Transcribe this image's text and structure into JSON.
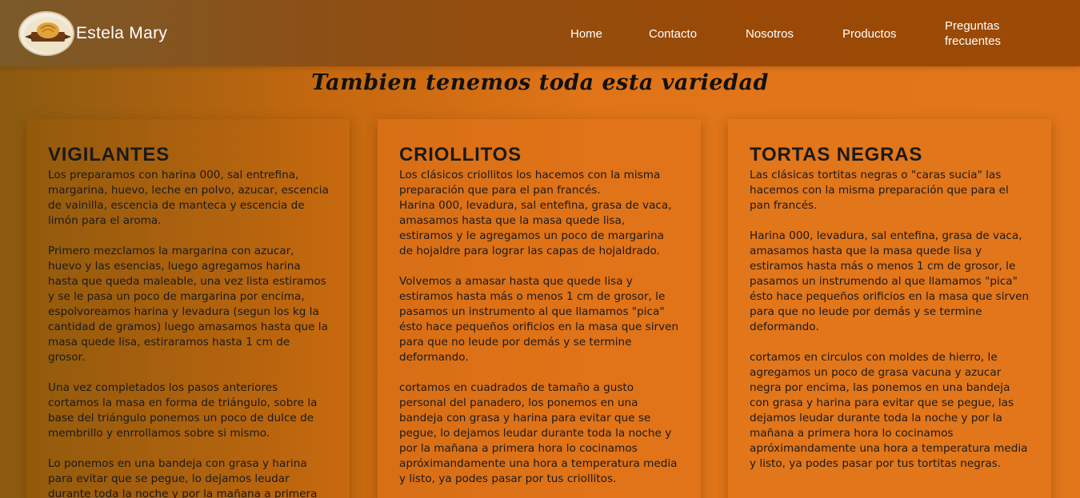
{
  "brand": {
    "name": "Estela Mary",
    "logo_icon": "bread-logo-icon"
  },
  "nav": {
    "home": "Home",
    "contacto": "Contacto",
    "nosotros": "Nosotros",
    "productos": "Productos",
    "faq": "Preguntas frecuentes"
  },
  "section": {
    "title": "Tambien tenemos toda esta variedad"
  },
  "cards": [
    {
      "title": "VIGILANTES",
      "paragraphs": [
        "Los preparamos con harina 000, sal entrefina, margarina, huevo, leche en polvo, azucar, escencia de vainilla, escencia de manteca y escencia de limón para el aroma.",
        "Primero mezclamos la margarina con azucar, huevo y las esencias, luego agregamos harina hasta que queda maleable, una vez lista estiramos y se le pasa un poco de margarina por encima, espolvoreamos harina y levadura (segun los kg la cantidad de gramos) luego amasamos hasta que la masa quede lisa, estiraramos hasta 1 cm de grosor.",
        "Una vez completados los pasos anteriores cortamos la masa en forma de triángulo, sobre la base del triángulo ponemos un poco de dulce de membrillo y enrrollamos sobre si mismo.",
        "Lo ponemos en una bandeja con grasa y harina para evitar que se pegue, lo dejamos leudar durante toda la noche y por la mañana a primera"
      ]
    },
    {
      "title": "CRIOLLITOS",
      "paragraphs": [
        "Los clásicos criollitos los hacemos con la misma preparación que para el pan francés.\nHarina 000, levadura, sal entefina, grasa de vaca, amasamos hasta que la masa quede lisa, estiramos y le agregamos un poco de margarina de hojaldre para lograr las capas de hojaldrado.",
        "Volvemos a amasar hasta que quede lisa y estiramos hasta más o menos 1 cm de grosor, le pasamos un instrumento al que llamamos \"pica\" ésto hace pequeños orificios en la masa que sirven para que no leude por demás y se termine deformando.",
        "cortamos en cuadrados de tamaño a gusto personal del panadero, los ponemos en una bandeja con grasa y harina para evitar que se pegue, lo dejamos leudar durante toda la noche y por la mañana a primera hora lo cocinamos apróximandamente una hora a temperatura media y listo, ya podes pasar por tus criollitos."
      ]
    },
    {
      "title": "TORTAS NEGRAS",
      "paragraphs": [
        "Las clásicas tortitas negras o \"caras sucia\" las hacemos con la misma preparación que para el pan francés.",
        "Harina 000, levadura, sal entefina, grasa de vaca, amasamos hasta que la masa quede lisa y estiramos hasta más o menos 1 cm de grosor, le pasamos un instrumendo al que llamamos \"pica\" ésto hace pequeños orificios en la masa que sirven para que no leude por demás y se termine deformando.",
        "cortamos en circulos con moldes de hierro, le agregamos un poco de grasa vacuna y azucar negra por encima, las ponemos en una bandeja con grasa y harina para evitar que se pegue, las dejamos leudar durante toda la noche y por la mañana a primera hora lo cocinamos apróximandamente una hora a temperatura media y listo, ya podes pasar por tus tortitas negras."
      ]
    }
  ]
}
